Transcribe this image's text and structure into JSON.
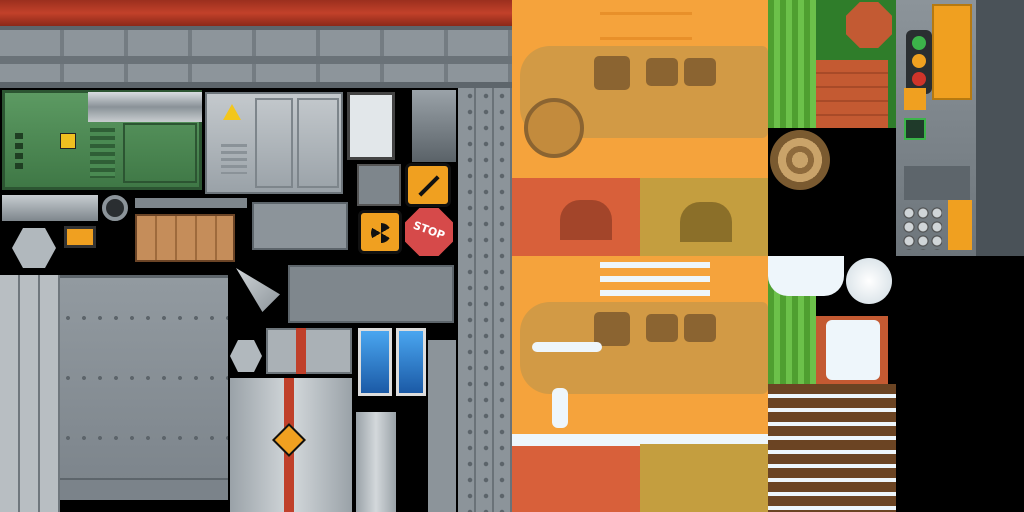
{
  "atlas": {
    "stop_sign_text": "STOP"
  },
  "colors": {
    "rust_red": "#b83a24",
    "metal_grey": "#8c949a",
    "bus_orange": "#f5a33c",
    "bus_yellow_dark": "#c9902f",
    "grass_green": "#5aa73a",
    "hazard_orange": "#f0a020",
    "snow_white": "#eef6fb",
    "glass_blue": "#2d86d8"
  },
  "icons": [
    "radiation-icon",
    "electric-hazard-icon",
    "arrows-sign-icon",
    "stop-sign-icon",
    "traffic-light-icon",
    "pedestrian-icon"
  ]
}
